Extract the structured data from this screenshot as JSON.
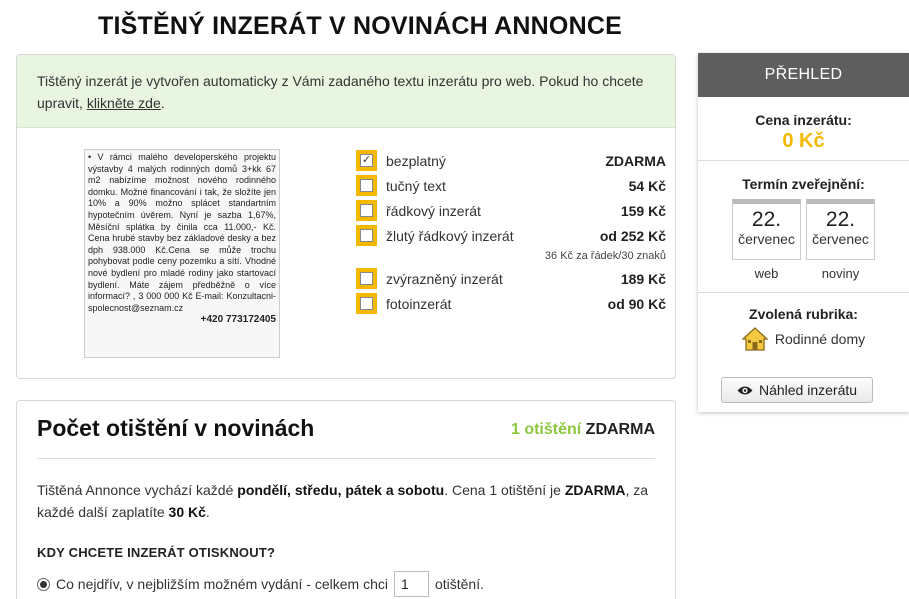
{
  "page": {
    "title": "TIŠTĚNÝ INZERÁT V NOVINÁCH ANNONCE"
  },
  "info": {
    "text": "Tištěný inzerát je vytvořen automaticky z Vámi zadaného textu inzerátu pro web. Pokud ho chcete upravit, ",
    "link": "klikněte zde",
    "end": "."
  },
  "ad_preview": {
    "text": "• V rámci malého developerského projektu výstavby 4 malých rodinných domů 3+kk 67 m2 nabízíme možnost nového rodinného domku. Možné financování i tak, že složíte jen 10% a 90% možno splácet standartním hypotečním úvěrem. Nyní je sazba 1,67%, Měsíční splátka by činila cca 11.000,- Kč. Cena hrubé stavby bez základové desky a bez dph 938.000 Kč.Cena se může trochu pohybovat podle ceny pozemku a sítí. Vhodné nové bydlení pro mladé rodiny jako startovací bydlení. Máte zájem předběžně o více informací? , 3 000 000 Kč E-mail: Konzultacni-spolecnost@seznam.cz",
    "phone": "+420 773172405"
  },
  "options": [
    {
      "label": "bezplatný",
      "price": "ZDARMA",
      "checked": "✓"
    },
    {
      "label": "tučný text",
      "price": "54 Kč",
      "checked": ""
    },
    {
      "label": "řádkový inzerát",
      "price": "159 Kč",
      "checked": ""
    },
    {
      "label": "žlutý řádkový inzerát",
      "price": "od 252 Kč",
      "checked": ""
    },
    {
      "label": "zvýrazněný inzerát",
      "price": "189 Kč",
      "checked": ""
    },
    {
      "label": "fotoinzerát",
      "price": "od 90 Kč",
      "checked": ""
    }
  ],
  "option_note": "36 Kč za řádek/30 znaků",
  "count": {
    "title": "Počet otištění v novinách",
    "value_green": "1 otištění",
    "value_black": "ZDARMA",
    "desc_1": "Tištěná Annonce vychází každé ",
    "desc_days": "pondělí, středu, pátek a sobotu",
    "desc_2": ". Cena 1 otištění je ",
    "desc_free": "ZDARMA",
    "desc_3": ", za každé další zaplatíte ",
    "desc_price": "30 Kč",
    "desc_4": ".",
    "when_title": "KDY CHCETE INZERÁT OTISKNOUT?",
    "radio_label": "Co nejdřív, v nejbližším možném vydání - celkem chci",
    "qty": "1",
    "radio_suffix": "otištění."
  },
  "summary": {
    "header": "PŘEHLED",
    "price_label": "Cena inzerátu:",
    "price_value": "0 Kč",
    "term_label": "Termín zveřejnění:",
    "web": {
      "day": "22.",
      "month": "červenec",
      "caption": "web"
    },
    "print": {
      "day": "22.",
      "month": "červenec",
      "caption": "noviny"
    },
    "rubric_label": "Zvolená rubrika:",
    "rubric_value": "Rodinné domy",
    "preview_button": "Náhled inzerátu"
  },
  "colors": {
    "accent": "#f5b800",
    "green": "#8dc63f",
    "header": "#5e5e5e",
    "info_bg": "#e8f5e0"
  },
  "icons": {
    "checkbox_checked": "check-icon",
    "rubric": "house-icon",
    "preview": "eye-icon"
  }
}
